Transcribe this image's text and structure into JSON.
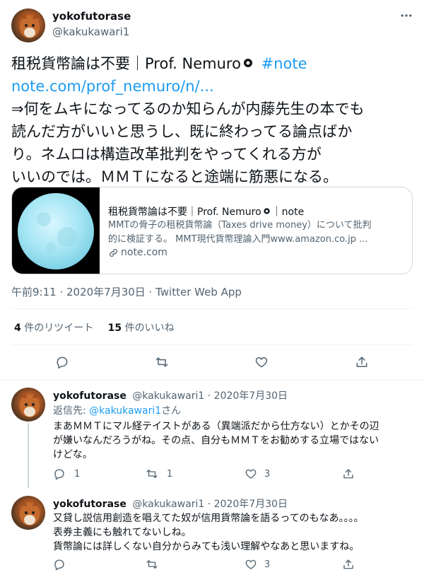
{
  "main_tweet": {
    "display_name": "yokofutorase",
    "handle": "@kakukawari1",
    "more_icon": "ellipsis-icon",
    "text_title": "租税貨幣論は不要｜Prof. Nemuro",
    "hashtag": "#note",
    "url": "note.com/prof_nemuro/n/...",
    "body_lines": [
      "⇒何をムキになってるのか知らんが内藤先生の本でも",
      "読んだ方がいいと思うし、既に終わってる論点ばか",
      "り。ネムロは構造改革批判をやってくれる方が",
      "いいのでは。ＭＭＴになると途端に筋悪になる。"
    ],
    "card": {
      "title": "租税貨幣論は不要｜Prof. Nemuro",
      "title_tail": "｜note",
      "desc_line1": "MMTの骨子の租税貨幣論（Taxes drive money）について批判",
      "desc_line2": "的に検証する。 MMT現代貨幣理論入門www.amazon.co.jp ...",
      "domain": "note.com"
    },
    "timestamp": "午前9:11 · 2020年7月30日 · Twitter Web App",
    "stats": {
      "retweets_count": "4",
      "retweets_label": "件のリツイート",
      "likes_count": "15",
      "likes_label": "件のいいね"
    }
  },
  "replies": [
    {
      "display_name": "yokofutorase",
      "handle_date": "@kakukawari1 · 2020年7月30日",
      "replying_label": "返信先:",
      "replying_handle": "@kakukawari1",
      "replying_suffix": "さん",
      "lines": [
        "まあＭＭＴにマル経テイストがある（異端派だから仕方ない）とかその辺",
        "が嫌いなんだろうがね。その点、自分もＭＭＴをお勧めする立場ではない",
        "けどな。"
      ],
      "reply_count": "1",
      "retweet_count": "1",
      "like_count": "3"
    },
    {
      "display_name": "yokofutorase",
      "handle_date": "@kakukawari1 · 2020年7月30日",
      "lines": [
        "又貸し説信用創造を唱えてた奴が信用貨幣論を語るってのもなあ。。。。",
        "表券主義にも触れてないしね。",
        "貨幣論には詳しくない自分からみても浅い理解やなあと思いますね。"
      ],
      "like_count": "3"
    }
  ],
  "colors": {
    "accent": "#1d9bf0",
    "muted": "#536471",
    "text": "#0f1419",
    "divider": "#eff3f4"
  }
}
